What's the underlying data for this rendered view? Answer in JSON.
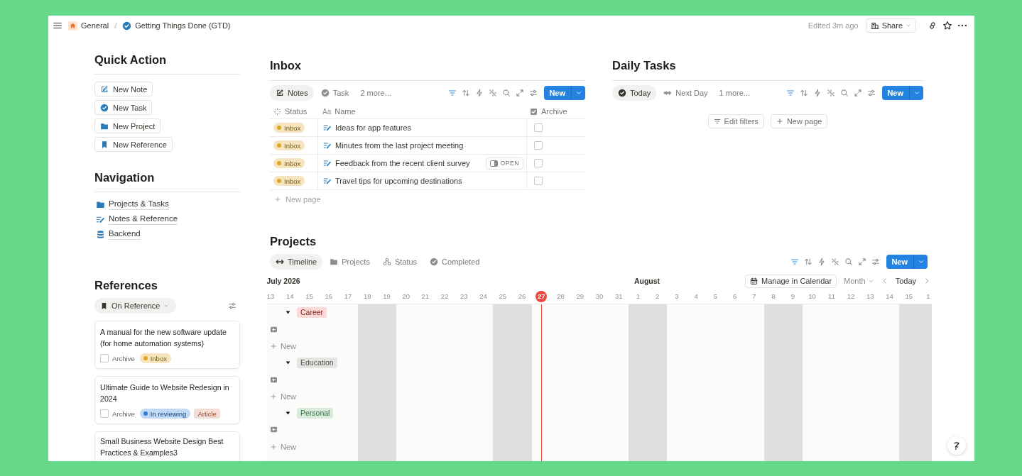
{
  "topbar": {
    "breadcrumb": [
      "General",
      "Getting Things Done (GTD)"
    ],
    "separator": "/",
    "edited": "Edited 3m ago",
    "share": "Share"
  },
  "quick_action": {
    "title": "Quick Action",
    "buttons": [
      "New Note",
      "New Task",
      "New Project",
      "New Reference"
    ]
  },
  "navigation": {
    "title": "Navigation",
    "links": [
      "Projects & Tasks",
      "Notes & Reference",
      "Backend"
    ]
  },
  "references": {
    "title": "References",
    "filter": "On Reference",
    "cards": [
      {
        "title": "A manual for the new software update (for home automation systems)",
        "archive_label": "Archive",
        "archived": false,
        "tags": [
          {
            "label": "Inbox",
            "kind": "status",
            "color": "#e0a526"
          }
        ]
      },
      {
        "title": "Ultimate Guide to Website Redesign in 2024",
        "archive_label": "Archive",
        "archived": false,
        "tags": [
          {
            "label": "In reviewing",
            "kind": "status",
            "color": "#2f7fdc"
          },
          {
            "label": "Article",
            "kind": "label",
            "color": "#f3ded6"
          }
        ]
      },
      {
        "title": "Small Business Website Design Best Practices & Examples3"
      }
    ]
  },
  "inbox": {
    "title": "Inbox",
    "views": [
      {
        "label": "Notes",
        "selected": true
      },
      {
        "label": "Task",
        "selected": false
      }
    ],
    "more": "2 more...",
    "new": "New",
    "columns": [
      "Status",
      "Name",
      "Archive"
    ],
    "name_glyph": "Aa",
    "rows": [
      {
        "status": {
          "label": "Inbox",
          "color": "#e0a526"
        },
        "name": "Ideas for app features",
        "archived": false
      },
      {
        "status": {
          "label": "Inbox",
          "color": "#e0a526"
        },
        "name": "Minutes from the last project meeting",
        "archived": false
      },
      {
        "status": {
          "label": "Inbox",
          "color": "#e0a526"
        },
        "name": "Feedback from the recent client survey",
        "archived": false,
        "open_label": "OPEN"
      },
      {
        "status": {
          "label": "Inbox",
          "color": "#e0a526"
        },
        "name": "Travel tips for upcoming destinations",
        "archived": false
      }
    ],
    "new_page": "New page"
  },
  "daily_tasks": {
    "title": "Daily Tasks",
    "views": [
      {
        "label": "Today",
        "selected": true
      },
      {
        "label": "Next Day",
        "selected": false
      }
    ],
    "more": "1 more...",
    "new": "New",
    "actions": [
      "Edit filters",
      "New page"
    ]
  },
  "projects": {
    "title": "Projects",
    "views": [
      {
        "label": "Timeline",
        "selected": true
      },
      {
        "label": "Projects",
        "selected": false
      },
      {
        "label": "Status",
        "selected": false
      },
      {
        "label": "Completed",
        "selected": false
      }
    ],
    "new": "New",
    "timeline": {
      "calendar_button": "Manage in Calendar",
      "scale": "Month",
      "today_button": "Today",
      "days": [
        {
          "day": "13",
          "month": "July 2026",
          "weekend": false,
          "today": false
        },
        {
          "day": "14",
          "weekend": false,
          "today": false
        },
        {
          "day": "15",
          "weekend": false,
          "today": false
        },
        {
          "day": "16",
          "weekend": false,
          "today": false
        },
        {
          "day": "17",
          "weekend": false,
          "today": false
        },
        {
          "day": "18",
          "weekend": true,
          "today": false
        },
        {
          "day": "19",
          "weekend": true,
          "today": false
        },
        {
          "day": "20",
          "weekend": false,
          "today": false
        },
        {
          "day": "21",
          "weekend": false,
          "today": false
        },
        {
          "day": "22",
          "weekend": false,
          "today": false
        },
        {
          "day": "23",
          "weekend": false,
          "today": false
        },
        {
          "day": "24",
          "weekend": false,
          "today": false
        },
        {
          "day": "25",
          "weekend": true,
          "today": false
        },
        {
          "day": "26",
          "weekend": true,
          "today": false
        },
        {
          "day": "27",
          "weekend": false,
          "today": true
        },
        {
          "day": "28",
          "weekend": false,
          "today": false
        },
        {
          "day": "29",
          "weekend": false,
          "today": false
        },
        {
          "day": "30",
          "weekend": false,
          "today": false
        },
        {
          "day": "31",
          "weekend": false,
          "today": false
        },
        {
          "day": "1",
          "month": "August",
          "weekend": true,
          "today": false
        },
        {
          "day": "2",
          "weekend": true,
          "today": false
        },
        {
          "day": "3",
          "weekend": false,
          "today": false
        },
        {
          "day": "4",
          "weekend": false,
          "today": false
        },
        {
          "day": "5",
          "weekend": false,
          "today": false
        },
        {
          "day": "6",
          "weekend": false,
          "today": false
        },
        {
          "day": "7",
          "weekend": false,
          "today": false
        },
        {
          "day": "8",
          "weekend": true,
          "today": false
        },
        {
          "day": "9",
          "weekend": true,
          "today": false
        },
        {
          "day": "10",
          "weekend": false,
          "today": false
        },
        {
          "day": "11",
          "weekend": false,
          "today": false
        },
        {
          "day": "12",
          "weekend": false,
          "today": false
        },
        {
          "day": "13",
          "weekend": false,
          "today": false
        },
        {
          "day": "14",
          "weekend": false,
          "today": false
        },
        {
          "day": "15",
          "weekend": true,
          "today": false
        },
        {
          "day": "1",
          "weekend": true,
          "today": false
        }
      ],
      "groups": [
        {
          "label": "Career",
          "color": "#fbd9d7",
          "expanded": true,
          "new_label": "New"
        },
        {
          "label": "Education",
          "color": "#e6e5e3",
          "expanded": true,
          "new_label": "New"
        },
        {
          "label": "Personal",
          "color": "#d8ecdc",
          "expanded": true,
          "new_label": "New"
        }
      ]
    }
  }
}
